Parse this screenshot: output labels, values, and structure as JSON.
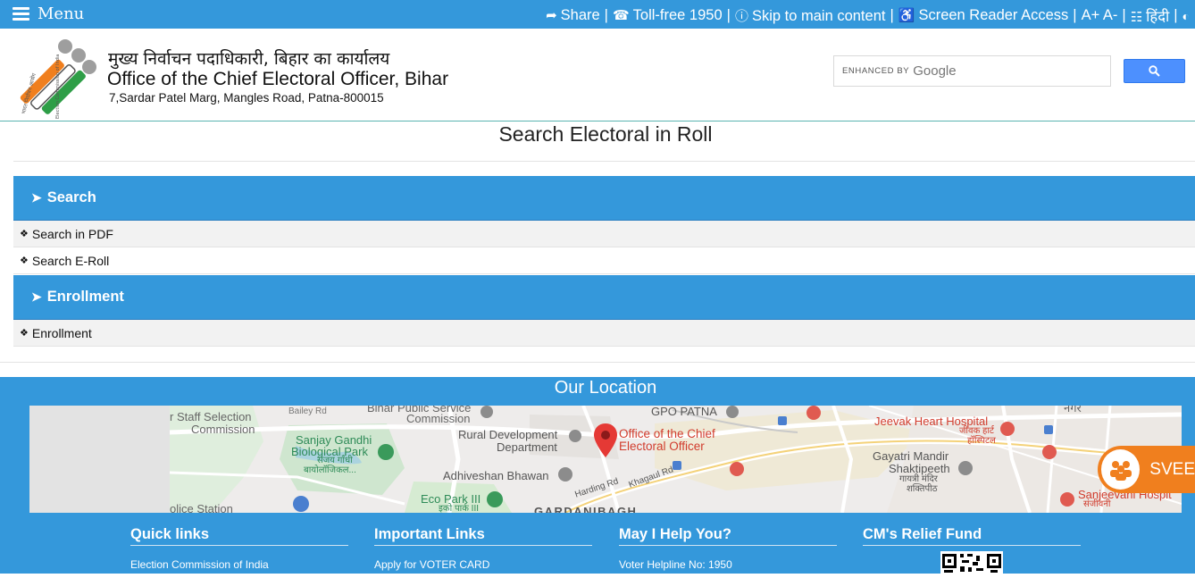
{
  "topbar": {
    "menu_label": "Menu",
    "share": "Share",
    "tollfree": "Toll-free 1950",
    "skip": "Skip to main content",
    "screen_reader": "Screen Reader Access",
    "font_size": "A+ A-",
    "hindi": "हिंदी",
    "separator": "|"
  },
  "header": {
    "title_hindi": "मुख्य निर्वाचन पदाधिकारी, बिहार का कार्यालय",
    "title_english": "Office of the Chief Electoral Officer, Bihar",
    "address": "7,Sardar Patel Marg, Mangles Road, Patna-800015",
    "search_enhanced": "ENHANCED BY",
    "search_google": "Google"
  },
  "page": {
    "title": "Search Electoral in Roll"
  },
  "sections": [
    {
      "title": "Search",
      "items": [
        "Search in PDF",
        "Search E-Roll"
      ]
    },
    {
      "title": "Enrollment",
      "items": [
        "Enrollment"
      ]
    }
  ],
  "location": {
    "title": "Our Location",
    "labels": {
      "staff1": "r Staff Selection",
      "staff2": "Commission",
      "bailey": "Bailey Rd",
      "bihar1": "Bihar Public Service",
      "bihar2": "Commission",
      "gpo": "GPO PATNA",
      "nagar": "नगर",
      "sanjay1": "Sanjay Gandhi",
      "sanjay2": "Biological Park",
      "sanjay_hi1": "संजय गाँधी",
      "sanjay_hi2": "बायोलॉजिकल...",
      "rural1": "Rural Development",
      "rural2": "Department",
      "ceo1": "Office of the Chief",
      "ceo2": "Electoral Officer",
      "jeevak": "Jeevak Heart Hospital",
      "jeevak_hi1": "जीवक हार्ट",
      "jeevak_hi2": "हॉस्पिटल",
      "adhiveshan": "Adhiveshan Bhawan",
      "harding": "Harding Rd",
      "khagaul": "Khagaul Rd",
      "gayatri1": "Gayatri Mandir",
      "gayatri2": "Shaktipeeth",
      "gayatri_hi1": "गायत्री मंदिर",
      "gayatri_hi2": "शक्तिपीठ",
      "eco": "Eco Park III",
      "eco_hi": "इको पार्क III",
      "gardani": "GARDANIBAGH",
      "police": "olice Station",
      "sanjeevani": "Sanjeevani Hospit",
      "sanjeevani_hi": "संजीवनी"
    }
  },
  "svee": {
    "label": "SVEE"
  },
  "footer": {
    "quick_links": {
      "title": "Quick links",
      "first": "Election Commission of India"
    },
    "important_links": {
      "title": "Important Links",
      "first": "Apply for VOTER CARD"
    },
    "help": {
      "title": "May I Help You?",
      "first": "Voter Helpline No: 1950"
    },
    "relief": {
      "title": "CM's Relief Fund"
    }
  },
  "colors": {
    "primary": "#3498db",
    "svee_orange": "#f07f1e",
    "map_pin": "#e53935",
    "map_red_text": "#d13c2d",
    "map_green_text": "#2e8b57"
  }
}
